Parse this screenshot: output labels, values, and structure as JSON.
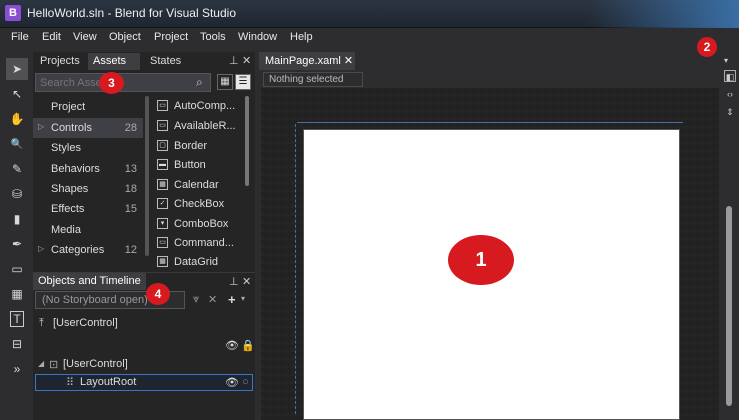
{
  "window": {
    "title": "HelloWorld.sln - Blend for Visual Studio",
    "app_icon": "B"
  },
  "menu": [
    "File",
    "Edit",
    "View",
    "Object",
    "Project",
    "Tools",
    "Window",
    "Help"
  ],
  "tools": [
    "selection-icon",
    "direct-selection-icon",
    "pan-icon",
    "zoom-icon",
    "eyedropper-icon",
    "paint-bucket-icon",
    "gradient-icon",
    "pen-icon",
    "rectangle-icon",
    "grid-icon",
    "text-icon",
    "control-icon",
    "more-tools-icon"
  ],
  "tools_glyphs": [
    "➤",
    "↖",
    "✋",
    "🔍",
    "✎",
    "⛁",
    "▮",
    "✒",
    "▭",
    "▦",
    "T",
    "⊟",
    "»"
  ],
  "assets_panel": {
    "tabs": [
      "Projects",
      "Assets",
      "States"
    ],
    "search_placeholder": "Search Assets",
    "categories": [
      {
        "label": "Project",
        "count": "",
        "arrow": ""
      },
      {
        "label": "Controls",
        "count": "28",
        "arrow": "▷"
      },
      {
        "label": "Styles",
        "count": "",
        "arrow": ""
      },
      {
        "label": "Behaviors",
        "count": "13",
        "arrow": ""
      },
      {
        "label": "Shapes",
        "count": "18",
        "arrow": ""
      },
      {
        "label": "Effects",
        "count": "15",
        "arrow": ""
      },
      {
        "label": "Media",
        "count": "",
        "arrow": ""
      },
      {
        "label": "Categories",
        "count": "12",
        "arrow": "▷"
      }
    ],
    "items": [
      {
        "label": "AutoComp...",
        "icon": "▭"
      },
      {
        "label": "AvailableR...",
        "icon": "▭"
      },
      {
        "label": "Border",
        "icon": "▢"
      },
      {
        "label": "Button",
        "icon": "▬"
      },
      {
        "label": "Calendar",
        "icon": "▦"
      },
      {
        "label": "CheckBox",
        "icon": "✓"
      },
      {
        "label": "ComboBox",
        "icon": "▾"
      },
      {
        "label": "Command...",
        "icon": "▭"
      },
      {
        "label": "DataGrid",
        "icon": "▦"
      }
    ]
  },
  "objects_panel": {
    "title": "Objects and Timeline",
    "storyboard": "(No Storyboard open)",
    "tree": [
      {
        "label": "[UserControl]"
      },
      {
        "label": "[UserControl]"
      },
      {
        "label": "LayoutRoot"
      }
    ]
  },
  "document": {
    "tab_label": "MainPage.xaml",
    "status": "Nothing selected"
  },
  "badges": [
    "1",
    "2",
    "3",
    "4"
  ],
  "colors": {
    "badge": "#d71920",
    "accent": "#3a75c4",
    "artboard": "#ffffff"
  }
}
